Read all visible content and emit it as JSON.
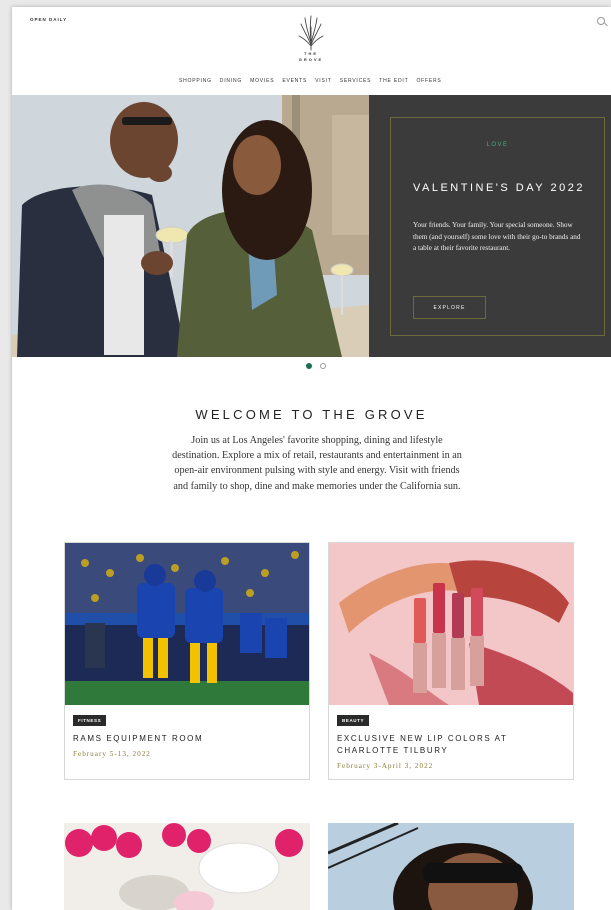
{
  "header": {
    "open_daily": "OPEN DAILY",
    "logo_the": "THE",
    "logo_grove": "GROVE",
    "nav": [
      "SHOPPING",
      "DINING",
      "MOVIES",
      "EVENTS",
      "VISIT",
      "SERVICES",
      "THE EDIT",
      "OFFERS"
    ]
  },
  "hero": {
    "eyebrow": "LOVE",
    "title": "VALENTINE'S DAY 2022",
    "body": "Your friends. Your family. Your special someone. Show them (and yourself) some love with their go-to brands and a table at their favorite restaurant.",
    "button": "EXPLORE",
    "slides": 2,
    "active_slide": 1
  },
  "welcome": {
    "title": "WELCOME TO THE GROVE",
    "text": "Join us at Los Angeles' favorite shopping, dining and lifestyle destination. Explore a mix of retail, restaurants and entertainment in an open-air environment pulsing with style and energy. Visit with friends and family to shop, dine and make memories under the California sun."
  },
  "cards": [
    {
      "tag": "FITNESS",
      "title": "RAMS EQUIPMENT ROOM",
      "date": "February 5-13, 2022"
    },
    {
      "tag": "BEAUTY",
      "title": "EXCLUSIVE NEW LIP COLORS AT CHARLOTTE TILBURY",
      "date": "February 3-April 3, 2022"
    }
  ],
  "colors": {
    "accent_green": "#1a6e55",
    "panel_bg": "#3b3b3b",
    "date_gold": "#8a7a3a"
  }
}
